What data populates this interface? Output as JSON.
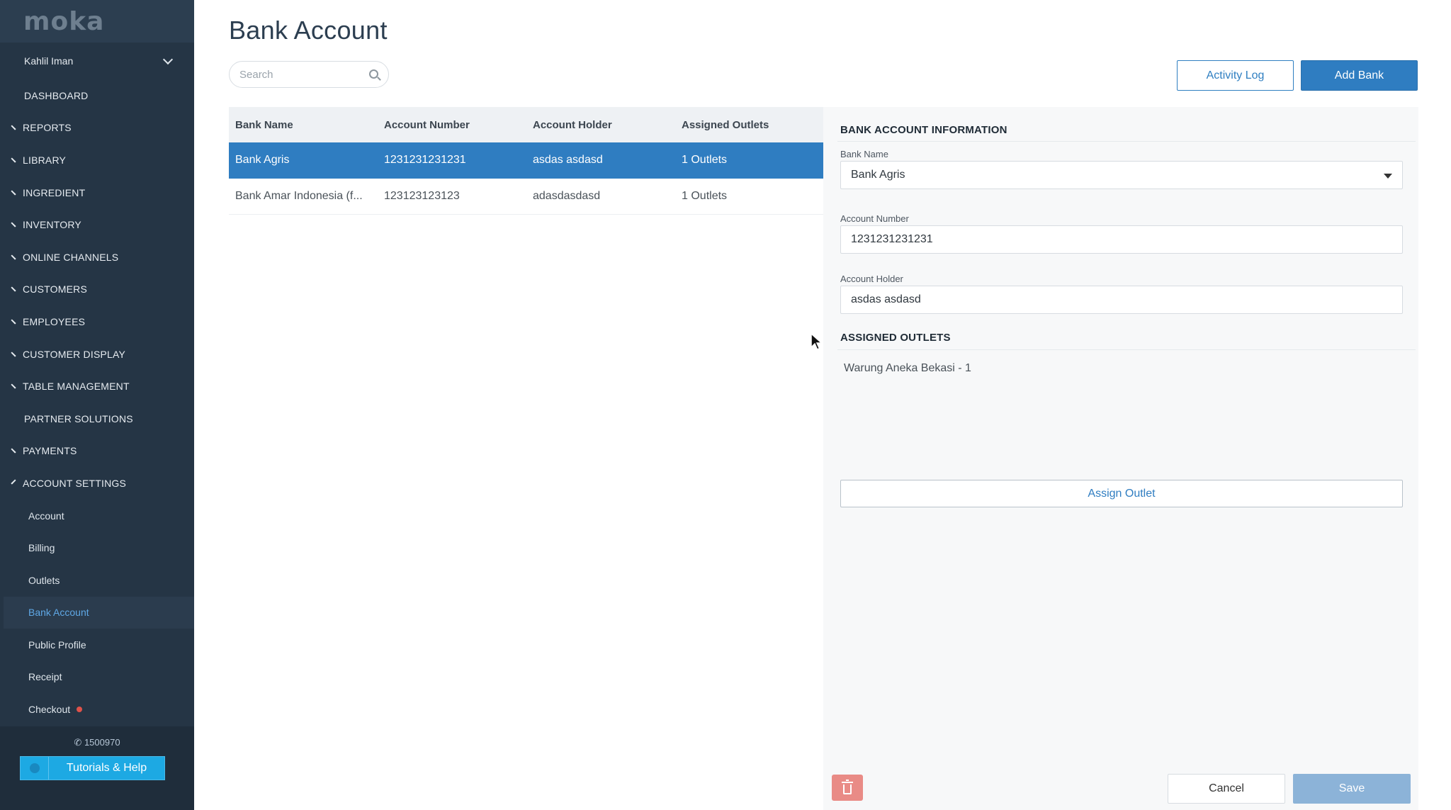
{
  "sidebar": {
    "logo": "moka",
    "user": "Kahlil Iman",
    "nav": [
      {
        "label": "DASHBOARD",
        "expandable": false
      },
      {
        "label": "REPORTS",
        "expandable": true
      },
      {
        "label": "LIBRARY",
        "expandable": true
      },
      {
        "label": "INGREDIENT",
        "expandable": true
      },
      {
        "label": "INVENTORY",
        "expandable": true
      },
      {
        "label": "ONLINE CHANNELS",
        "expandable": true
      },
      {
        "label": "CUSTOMERS",
        "expandable": true
      },
      {
        "label": "EMPLOYEES",
        "expandable": true
      },
      {
        "label": "CUSTOMER DISPLAY",
        "expandable": true
      },
      {
        "label": "TABLE MANAGEMENT",
        "expandable": true
      },
      {
        "label": "PARTNER SOLUTIONS",
        "expandable": false
      },
      {
        "label": "PAYMENTS",
        "expandable": true
      },
      {
        "label": "ACCOUNT SETTINGS",
        "expandable": true,
        "expanded": true
      }
    ],
    "account_settings_items": [
      "Account",
      "Billing",
      "Outlets",
      "Bank Account",
      "Public Profile",
      "Receipt",
      "Checkout"
    ],
    "active_item": "Bank Account",
    "phone": "1500970",
    "help_button": "Tutorials & Help"
  },
  "main": {
    "title": "Bank Account",
    "search_placeholder": "Search",
    "activity_log_label": "Activity Log",
    "add_bank_label": "Add Bank",
    "table": {
      "headers": [
        "Bank Name",
        "Account Number",
        "Account Holder",
        "Assigned Outlets"
      ],
      "rows": [
        {
          "bank_name": "Bank Agris",
          "account_number": "1231231231231",
          "account_holder": "asdas asdasd",
          "assigned_outlets": "1 Outlets",
          "selected": true
        },
        {
          "bank_name": "Bank Amar Indonesia (f...",
          "account_number": "123123123123",
          "account_holder": "adasdasdasd",
          "assigned_outlets": "1 Outlets",
          "selected": false
        }
      ]
    }
  },
  "detail": {
    "info_title": "BANK ACCOUNT INFORMATION",
    "bank_name_label": "Bank Name",
    "bank_name_value": "Bank Agris",
    "account_number_label": "Account Number",
    "account_number_value": "1231231231231",
    "account_holder_label": "Account Holder",
    "account_holder_value": "asdas asdasd",
    "outlets_title": "ASSIGNED OUTLETS",
    "outlets": [
      "Warung Aneka Bekasi - 1"
    ],
    "assign_outlet_label": "Assign Outlet",
    "cancel_label": "Cancel",
    "save_label": "Save"
  },
  "colors": {
    "sidebar_bg": "#253545",
    "primary": "#2f7dc1",
    "active_link": "#5fa8e6",
    "delete_bg": "#e98b86",
    "save_disabled": "#8cb3d8",
    "notification_dot": "#e0524a"
  }
}
